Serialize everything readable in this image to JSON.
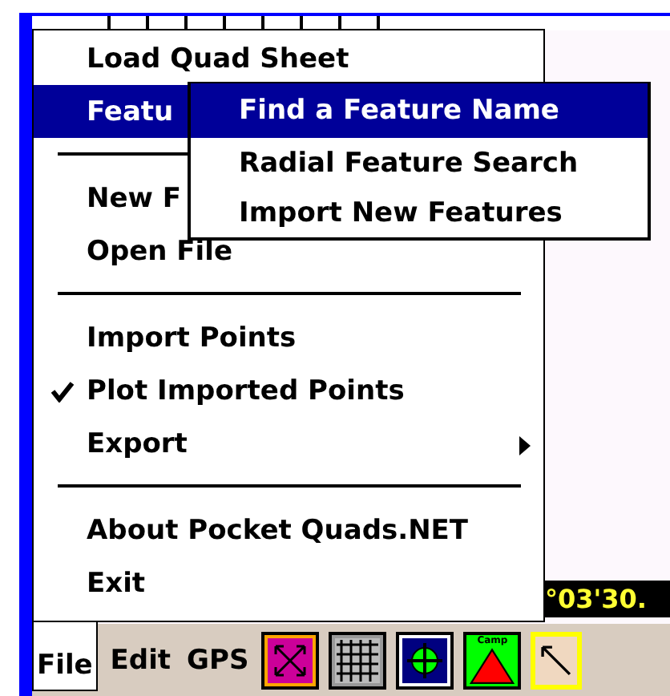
{
  "file_menu": {
    "items": [
      {
        "kind": "item",
        "label": "Load Quad Sheet",
        "selected": false,
        "checked": false,
        "has_submenu": false
      },
      {
        "kind": "item",
        "label": "Featu",
        "selected": true,
        "checked": false
      },
      {
        "kind": "separator"
      },
      {
        "kind": "item",
        "label": "New F",
        "selected": false,
        "checked": false
      },
      {
        "kind": "item",
        "label": "Open File",
        "selected": false,
        "checked": false,
        "has_submenu": false
      },
      {
        "kind": "separator"
      },
      {
        "kind": "item",
        "label": "Import Points",
        "selected": false,
        "checked": false,
        "has_submenu": false
      },
      {
        "kind": "item",
        "label": "Plot Imported Points",
        "selected": false,
        "checked": true,
        "has_submenu": false
      },
      {
        "kind": "item",
        "label": "Export",
        "selected": false,
        "checked": false,
        "has_submenu": true
      },
      {
        "kind": "separator"
      },
      {
        "kind": "item",
        "label": "About Pocket Quads.NET",
        "selected": false,
        "checked": false,
        "has_submenu": false
      },
      {
        "kind": "item",
        "label": "Exit",
        "selected": false,
        "checked": false,
        "has_submenu": false
      }
    ]
  },
  "features_submenu": {
    "items": [
      {
        "label": "Find a Feature Name",
        "selected": true
      },
      {
        "label": "Radial Feature Search",
        "selected": false
      },
      {
        "label": "Import New Features",
        "selected": false
      }
    ]
  },
  "coordinate_readout": "°03'30.",
  "menu_bar": {
    "menus": [
      {
        "label": "File",
        "selected": true
      },
      {
        "label": "Edit",
        "selected": false
      },
      {
        "label": "GPS",
        "selected": false
      }
    ],
    "tools": [
      {
        "kind": "pan"
      },
      {
        "kind": "grid"
      },
      {
        "kind": "center"
      },
      {
        "kind": "camp",
        "label": "Camp"
      },
      {
        "kind": "pointer"
      }
    ]
  }
}
